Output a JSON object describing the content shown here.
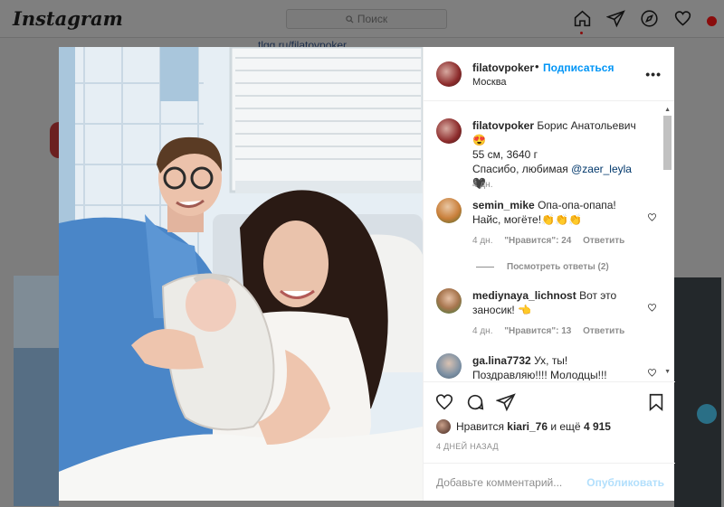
{
  "topbar": {
    "logo": "Instagram",
    "search_placeholder": "Поиск",
    "icons": [
      "home-icon",
      "direct-icon",
      "explore-icon",
      "heart-icon",
      "profile-avatar"
    ]
  },
  "background": {
    "link": "tlgg.ru/filatovpoker"
  },
  "post": {
    "username": "filatovpoker",
    "follow": "Подписаться",
    "location": "Москва",
    "caption": {
      "username": "filatovpoker",
      "line1": "Борис Анатольевич😍",
      "line2": "55 см, 3640 г",
      "line3_prefix": "Спасибо, любимая ",
      "mention": "@zaer_leyla",
      "line3_suffix": "🖤",
      "time": "4 дн."
    },
    "comments": [
      {
        "username": "semin_mike",
        "text": "Опа-опа-опапа! Найс, могёте!👏👏👏",
        "time": "4 дн.",
        "likes": "\"Нравится\": 24",
        "reply": "Ответить",
        "view_replies": "Посмотреть ответы (2)"
      },
      {
        "username": "mediynaya_lichnost",
        "text": "Вот это заносик! 👈",
        "time": "4 дн.",
        "likes": "\"Нравится\": 13",
        "reply": "Ответить"
      },
      {
        "username": "ga.lina7732",
        "text": "Ух, ты! Поздравляю!!!! Молодцы!!!"
      }
    ],
    "likes_prefix": "Нравится ",
    "likes_user": "kiari_76",
    "likes_middle": " и ещё ",
    "likes_count": "4 915",
    "posted": "4 ДНЕЙ НАЗАД",
    "add_comment_placeholder": "Добавьте комментарий...",
    "publish": "Опубликовать"
  },
  "colors": {
    "accent": "#0095f6",
    "publish_disabled": "#b2dffc",
    "overlay": "#7d7d7d"
  }
}
